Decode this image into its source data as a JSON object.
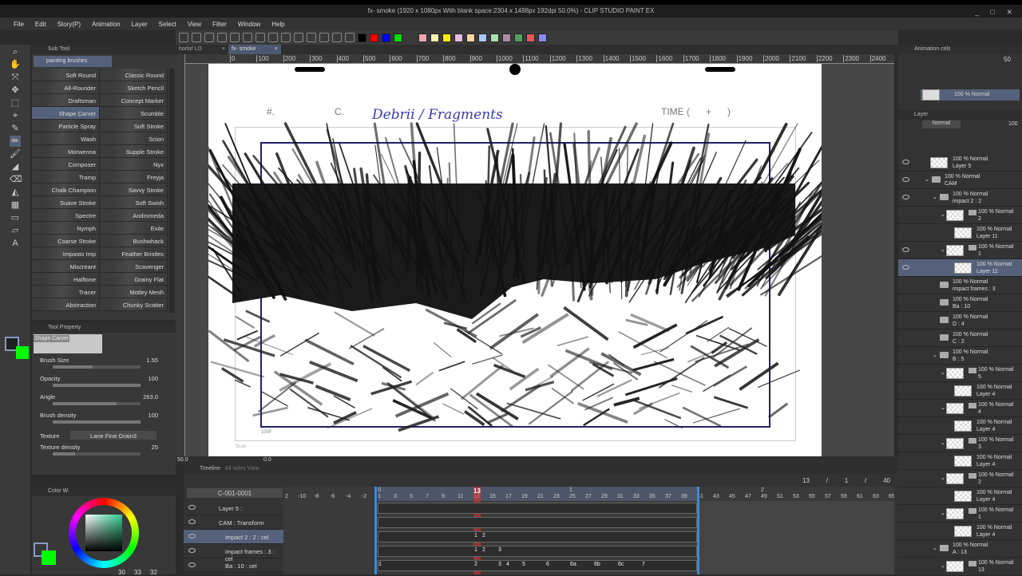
{
  "window": {
    "title": "fx- smoke (1920 x 1080px With blank space:2304 x 1488px 192dpi 50.0%) - CLIP STUDIO PAINT EX",
    "controls": "_ □ ✕"
  },
  "menu": [
    "File",
    "Edit",
    "Story(P)",
    "Animation",
    "Layer",
    "Select",
    "View",
    "Filter",
    "Window",
    "Help"
  ],
  "toolbar": {
    "colors": [
      "#000000",
      "#ff0000",
      "#0000ff",
      "#00dd00",
      "#f4a6b0",
      "#fff4b0",
      "#ffee00",
      "#e9b8e6",
      "#ffd8a0",
      "#a8c8ff",
      "#a8e6b0",
      "#b08aa8",
      "#50a060",
      "#ee5555",
      "#8888ff"
    ]
  },
  "tabs": [
    {
      "label": "horlof LO",
      "active": false
    },
    {
      "label": "fx- smoke",
      "active": true
    }
  ],
  "ruler": [
    "0",
    "100",
    "200",
    "300",
    "400",
    "500",
    "600",
    "700",
    "800",
    "900",
    "1000",
    "1100",
    "1200",
    "1300",
    "1400",
    "1500",
    "1600",
    "1700",
    "1800",
    "1900",
    "2000",
    "2100",
    "2200",
    "2300",
    "2400",
    "2500"
  ],
  "canvas": {
    "hash": "#.",
    "cut": "C.",
    "handwritten": "Debrii / Fragments",
    "time": "TIME (      +      )",
    "frame_label": "100F",
    "scan_label": "Scan"
  },
  "status": {
    "zoom": "50.0",
    "angle": "0.0"
  },
  "subtool": {
    "tab": "Sub Tool",
    "group": "painting brushes",
    "brushes": [
      "Soft Round",
      "Classic Round",
      "All-Rounder",
      "Sketch Pencil",
      "Draftsman",
      "Concept Marker",
      "Shape Carver",
      "Scumble",
      "Particle Spray",
      "Soft Stroke",
      "Wash",
      "Scion",
      "Morwenna",
      "Supple Stroke",
      "Composer",
      "Nyx",
      "Tramp",
      "Freyja",
      "Chalk Champion",
      "Savvy Stroke",
      "Suave Stroke",
      "Soft Swish",
      "Spectre",
      "Andromeda",
      "Nymph",
      "Exile",
      "Coarse Stroke",
      "Bushwhack",
      "Impasto Imp",
      "Feather Bristles",
      "Miscreant",
      "Scavenger",
      "Halftone",
      "Grainy Flat",
      "Tracer",
      "Motley Mesh",
      "Abstraction",
      "Chunky Scatter"
    ],
    "selected": "Shape Carver"
  },
  "toolprop": {
    "tab": "Tool Property",
    "brush": "Shape Carver",
    "props": [
      {
        "label": "Brush Size",
        "value": "1.55",
        "fill": 0.45
      },
      {
        "label": "Opacity",
        "value": "100",
        "fill": 1
      },
      {
        "label": "Angle",
        "value": "263.0",
        "fill": 0.73
      },
      {
        "label": "Brush density",
        "value": "100",
        "fill": 1
      }
    ],
    "texture_label": "Texture",
    "texture_value": "Lane Fine Grain3",
    "texture_density_label": "Texture density",
    "texture_density_value": "25"
  },
  "colorpanel": {
    "tab": "Color W",
    "r": "30",
    "g": "33",
    "b": "32",
    "main_color": "#1e2120",
    "sub_color": "#00ff00"
  },
  "animcels": {
    "tab": "Animation cels",
    "opacity": "50",
    "cel": "100 % Normal"
  },
  "layerpanel": {
    "tab": "Layer",
    "blend": "Normal",
    "opacity": "100",
    "layers": [
      {
        "mode": "100 % Normal",
        "name": "Layer 5",
        "indent": 0,
        "kind": "raster",
        "eye": true
      },
      {
        "mode": "100 % Normal",
        "name": "CAM",
        "indent": 0,
        "kind": "folder",
        "eye": true,
        "open": true
      },
      {
        "mode": "100 % Normal",
        "name": "impact 2 : 2",
        "indent": 1,
        "kind": "anim",
        "eye": true,
        "open": true
      },
      {
        "mode": "100 % Normal",
        "name": "2",
        "indent": 2,
        "kind": "cel",
        "eye": false,
        "open": true
      },
      {
        "mode": "100 % Normal",
        "name": "Layer 11",
        "indent": 3,
        "kind": "raster",
        "eye": false
      },
      {
        "mode": "100 % Normal",
        "name": "1",
        "indent": 2,
        "kind": "cel",
        "eye": true,
        "open": true
      },
      {
        "mode": "100 % Normal",
        "name": "Layer 11",
        "indent": 3,
        "kind": "raster",
        "eye": true,
        "selected": true
      },
      {
        "mode": "100 % Normal",
        "name": "impact frames : 3",
        "indent": 1,
        "kind": "anim",
        "eye": false
      },
      {
        "mode": "100 % Normal",
        "name": "Ba : 10",
        "indent": 1,
        "kind": "anim",
        "eye": false
      },
      {
        "mode": "100 % Normal",
        "name": "D : 4",
        "indent": 1,
        "kind": "anim",
        "eye": false
      },
      {
        "mode": "100 % Normal",
        "name": "C : 2",
        "indent": 1,
        "kind": "anim",
        "eye": false
      },
      {
        "mode": "100 % Normal",
        "name": "B : 5",
        "indent": 1,
        "kind": "anim",
        "eye": false,
        "open": true
      },
      {
        "mode": "100 % Normal",
        "name": "5",
        "indent": 2,
        "kind": "cel",
        "eye": false,
        "open": true
      },
      {
        "mode": "100 % Normal",
        "name": "Layer 4",
        "indent": 3,
        "kind": "raster",
        "eye": false
      },
      {
        "mode": "100 % Normal",
        "name": "4",
        "indent": 2,
        "kind": "cel",
        "eye": false,
        "open": true
      },
      {
        "mode": "100 % Normal",
        "name": "Layer 4",
        "indent": 3,
        "kind": "raster",
        "eye": false
      },
      {
        "mode": "100 % Normal",
        "name": "3",
        "indent": 2,
        "kind": "cel",
        "eye": false,
        "open": true
      },
      {
        "mode": "100 % Normal",
        "name": "Layer 4",
        "indent": 3,
        "kind": "raster",
        "eye": false
      },
      {
        "mode": "100 % Normal",
        "name": "2",
        "indent": 2,
        "kind": "cel",
        "eye": false,
        "open": true
      },
      {
        "mode": "100 % Normal",
        "name": "Layer 4",
        "indent": 3,
        "kind": "raster",
        "eye": false
      },
      {
        "mode": "100 % Normal",
        "name": "1",
        "indent": 2,
        "kind": "cel",
        "eye": false,
        "open": true
      },
      {
        "mode": "100 % Normal",
        "name": "Layer 4",
        "indent": 3,
        "kind": "raster",
        "eye": false
      },
      {
        "mode": "100 % Normal",
        "name": "A : 13",
        "indent": 1,
        "kind": "anim",
        "eye": false,
        "open": true
      },
      {
        "mode": "100 % Normal",
        "name": "13",
        "indent": 2,
        "kind": "cel",
        "eye": false,
        "open": true
      }
    ]
  },
  "timeline": {
    "tab": "Timeline",
    "tab2": "All sides View",
    "name": "C-001-0001",
    "current": "13",
    "counter": [
      "13",
      "/",
      "1",
      "/",
      "40"
    ],
    "frame_labels": [
      "2",
      "-10",
      "-8",
      "-6",
      "-4",
      "-2",
      "1",
      "3",
      "5",
      "7",
      "9",
      "11",
      "13",
      "15",
      "17",
      "19",
      "21",
      "23",
      "25",
      "27",
      "29",
      "31",
      "33",
      "35",
      "37",
      "39",
      "41",
      "43",
      "45",
      "47",
      "49",
      "51",
      "53",
      "55",
      "57",
      "59",
      "61",
      "63",
      "65"
    ],
    "sec_labels": [
      "0",
      "1",
      "2"
    ],
    "tracks": [
      {
        "name": "Layer 5 :",
        "cels": []
      },
      {
        "name": "CAM : Transform",
        "cels": []
      },
      {
        "name": "impact 2 : 2 : cel",
        "cels": [
          {
            "f": 13,
            "t": "1"
          },
          {
            "f": 14,
            "t": "2"
          }
        ],
        "selected": true
      },
      {
        "name": "impact frames : 3 : cel",
        "cels": [
          {
            "f": 13,
            "t": "1"
          },
          {
            "f": 14,
            "t": "2"
          },
          {
            "f": 16,
            "t": "3"
          }
        ]
      },
      {
        "name": "Ba : 10 : cel",
        "cels": [
          {
            "f": 1,
            "t": "1"
          },
          {
            "f": 13,
            "t": "2"
          },
          {
            "f": 16,
            "t": "3"
          },
          {
            "f": 17,
            "t": "4"
          },
          {
            "f": 19,
            "t": "5"
          },
          {
            "f": 22,
            "t": "6"
          },
          {
            "f": 25,
            "t": "6a"
          },
          {
            "f": 28,
            "t": "6b"
          },
          {
            "f": 31,
            "t": "6c"
          },
          {
            "f": 34,
            "t": "7"
          }
        ]
      }
    ]
  }
}
